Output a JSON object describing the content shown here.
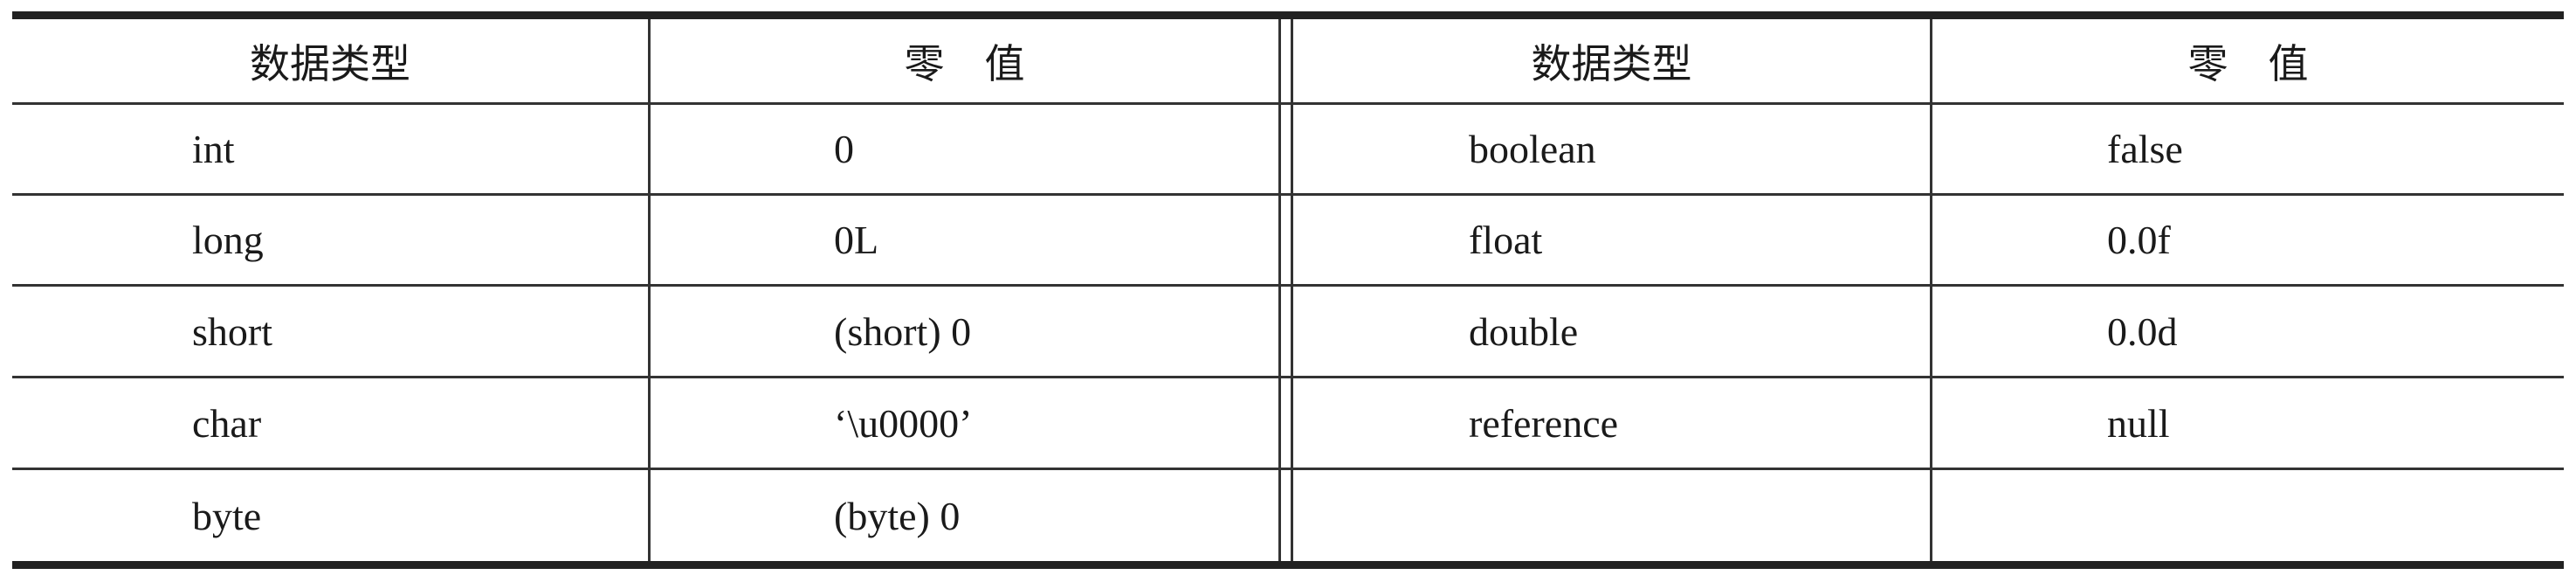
{
  "table": {
    "headers": [
      "数据类型",
      "零　值",
      "数据类型",
      "零　值"
    ],
    "rows": [
      [
        "int",
        "0",
        "boolean",
        "false"
      ],
      [
        "long",
        "0L",
        "float",
        "0.0f"
      ],
      [
        "short",
        "(short) 0",
        "double",
        "0.0d"
      ],
      [
        "char",
        "‘\\u0000’",
        "reference",
        "null"
      ],
      [
        "byte",
        "(byte) 0",
        "",
        ""
      ]
    ]
  }
}
